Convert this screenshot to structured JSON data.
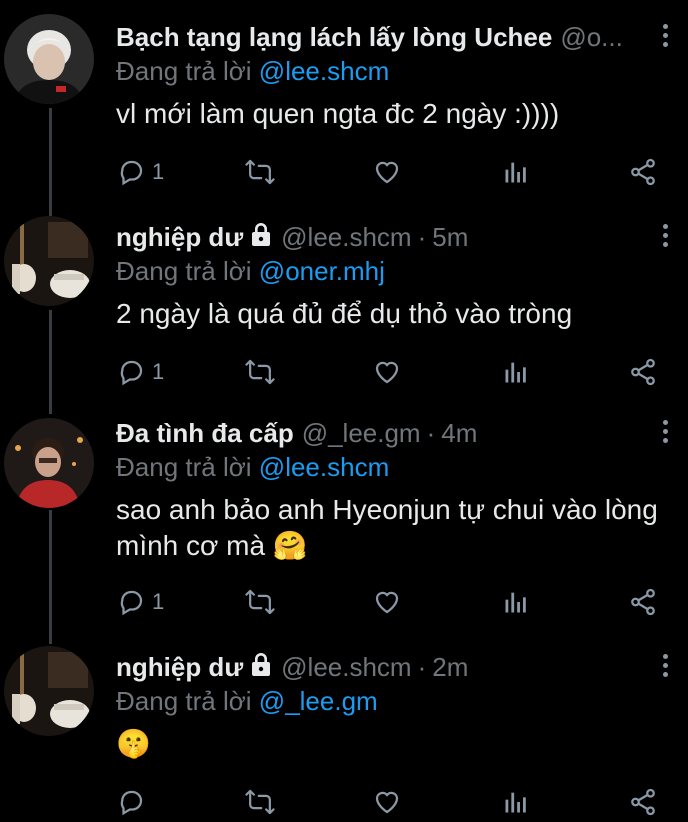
{
  "tweets": [
    {
      "name": "Bạch tạng lạng lách lấy lòng Uchee",
      "handle": "@o...",
      "locked": false,
      "time": "",
      "reply_prefix": "Đang trả lời",
      "reply_to": "@lee.shcm",
      "text": "vl mới làm quen ngta đc 2 ngày :))))",
      "replies": "1"
    },
    {
      "name": "nghiệp dư",
      "handle": "@lee.shcm",
      "locked": true,
      "time": "5m",
      "reply_prefix": "Đang trả lời",
      "reply_to": "@oner.mhj",
      "text": "2 ngày là quá đủ để dụ thỏ vào tròng",
      "replies": "1"
    },
    {
      "name": "Đa tình đa cấp",
      "handle": "@_lee.gm",
      "locked": false,
      "time": "4m",
      "reply_prefix": "Đang trả lời",
      "reply_to": "@lee.shcm",
      "text": "sao anh bảo anh Hyeonjun tự chui vào lòng mình cơ mà 🤗",
      "replies": "1"
    },
    {
      "name": "nghiệp dư",
      "handle": "@lee.shcm",
      "locked": true,
      "time": "2m",
      "reply_prefix": "Đang trả lời",
      "reply_to": "@_lee.gm",
      "text": "🤫",
      "replies": ""
    }
  ],
  "icons": {
    "reply": "reply-icon",
    "retweet": "retweet-icon",
    "like": "heart-icon",
    "views": "views-icon",
    "share": "share-icon",
    "more": "more-icon",
    "lock": "lock-icon"
  },
  "colors": {
    "background": "#000000",
    "text": "#e7e9ea",
    "muted": "#71767b",
    "link": "#1d9bf0",
    "icon": "#8b98a5",
    "thread_line": "#3a3d40"
  }
}
